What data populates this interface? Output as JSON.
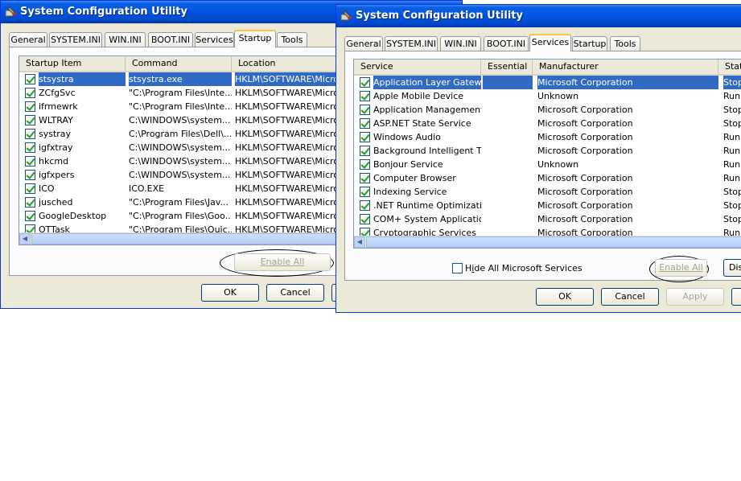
{
  "left_window": {
    "title": "System Configuration Utility",
    "tabs": [
      "General",
      "SYSTEM.INI",
      "WIN.INI",
      "BOOT.INI",
      "Services",
      "Startup",
      "Tools"
    ],
    "active_tab": "Startup",
    "columns": [
      "Startup Item",
      "Command",
      "Location"
    ],
    "rows": [
      {
        "item": "stsystra",
        "command": "stsystra.exe",
        "location": "HKLM\\SOFTWARE\\Microsc",
        "checked": true,
        "selected": true
      },
      {
        "item": "ZCfgSvc",
        "command": "\"C:\\Program Files\\Inte...",
        "location": "HKLM\\SOFTWARE\\Microsc",
        "checked": true
      },
      {
        "item": "ifrmewrk",
        "command": "\"C:\\Program Files\\Inte...",
        "location": "HKLM\\SOFTWARE\\Microsc",
        "checked": true
      },
      {
        "item": "WLTRAY",
        "command": "C:\\WINDOWS\\system...",
        "location": "HKLM\\SOFTWARE\\Microsc",
        "checked": true
      },
      {
        "item": "systray",
        "command": "C:\\Program Files\\Dell\\...",
        "location": "HKLM\\SOFTWARE\\Microsc",
        "checked": true
      },
      {
        "item": "igfxtray",
        "command": "C:\\WINDOWS\\system...",
        "location": "HKLM\\SOFTWARE\\Microsc",
        "checked": true
      },
      {
        "item": "hkcmd",
        "command": "C:\\WINDOWS\\system...",
        "location": "HKLM\\SOFTWARE\\Microsc",
        "checked": true
      },
      {
        "item": "igfxpers",
        "command": "C:\\WINDOWS\\system...",
        "location": "HKLM\\SOFTWARE\\Microsc",
        "checked": true
      },
      {
        "item": "ICO",
        "command": "ICO.EXE",
        "location": "HKLM\\SOFTWARE\\Microsc",
        "checked": true
      },
      {
        "item": "jusched",
        "command": "\"C:\\Program Files\\Jav...",
        "location": "HKLM\\SOFTWARE\\Microsc",
        "checked": true
      },
      {
        "item": "GoogleDesktop",
        "command": "\"C:\\Program Files\\Goo...",
        "location": "HKLM\\SOFTWARE\\Microsc",
        "checked": true
      },
      {
        "item": "OTTask",
        "command": "\"C:\\Program Files\\Quic...",
        "location": "HKLM\\SOFTWARE\\Microsc",
        "checked": true
      }
    ],
    "enable_all_label": "Enable All",
    "ok_label": "OK",
    "cancel_label": "Cancel"
  },
  "right_window": {
    "title": "System Configuration Utility",
    "tabs": [
      "General",
      "SYSTEM.INI",
      "WIN.INI",
      "BOOT.INI",
      "Services",
      "Startup",
      "Tools"
    ],
    "active_tab": "Services",
    "columns": [
      "Service",
      "Essential",
      "Manufacturer",
      "Stat"
    ],
    "rows": [
      {
        "service": "Application Layer Gatew...",
        "essential": "",
        "manufacturer": "Microsoft Corporation",
        "status": "Stop",
        "checked": true,
        "selected": true
      },
      {
        "service": "Apple Mobile Device",
        "essential": "",
        "manufacturer": "Unknown",
        "status": "Runn",
        "checked": true
      },
      {
        "service": "Application Management",
        "essential": "",
        "manufacturer": "Microsoft Corporation",
        "status": "Stop",
        "checked": true
      },
      {
        "service": "ASP.NET State Service",
        "essential": "",
        "manufacturer": "Microsoft Corporation",
        "status": "Stop",
        "checked": true
      },
      {
        "service": "Windows Audio",
        "essential": "",
        "manufacturer": "Microsoft Corporation",
        "status": "Runn",
        "checked": true
      },
      {
        "service": "Background Intelligent T...",
        "essential": "",
        "manufacturer": "Microsoft Corporation",
        "status": "Runn",
        "checked": true
      },
      {
        "service": "Bonjour Service",
        "essential": "",
        "manufacturer": "Unknown",
        "status": "Runn",
        "checked": true
      },
      {
        "service": "Computer Browser",
        "essential": "",
        "manufacturer": "Microsoft Corporation",
        "status": "Runn",
        "checked": true
      },
      {
        "service": "Indexing Service",
        "essential": "",
        "manufacturer": "Microsoft Corporation",
        "status": "Stop",
        "checked": true
      },
      {
        "service": ".NET Runtime Optimizati...",
        "essential": "",
        "manufacturer": "Microsoft Corporation",
        "status": "Stop",
        "checked": true
      },
      {
        "service": "COM+ System Application",
        "essential": "",
        "manufacturer": "Microsoft Corporation",
        "status": "Stop",
        "checked": true
      },
      {
        "service": "Cryptographic Services",
        "essential": "",
        "manufacturer": "Microsoft Corporation",
        "status": "Runn",
        "checked": true
      }
    ],
    "hide_ms_label_pre": "H",
    "hide_ms_label_accel": "i",
    "hide_ms_label_post": "de All Microsoft Services",
    "hide_ms_checked": false,
    "enable_all_label": "Enable All",
    "disable_all_label": "Dis",
    "ok_label": "OK",
    "cancel_label": "Cancel",
    "apply_label": "Apply"
  },
  "colors": {
    "title_bar": "#0054e3",
    "window_bg": "#ece9d8",
    "selection": "#316ac5",
    "active_tab_accent": "#ffc83c",
    "checkmark": "#21a121"
  }
}
